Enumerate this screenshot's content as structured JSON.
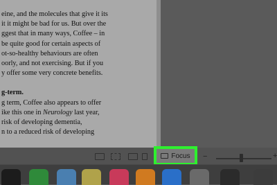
{
  "document": {
    "lines": [
      "eine, and the molecules that give it its",
      "it it might be bad for us. But over the",
      "ggest that in many ways, Coffee – in",
      "be quite good for certain aspects of",
      "ot-so-healthy behaviours are often",
      "oorly, and not exercising. But if you",
      "y offer some very concrete benefits."
    ],
    "heading": "g-term.",
    "lines2": [
      "g term, Coffee also appears to offer",
      "ike this one in Neurology last year,",
      "risk of developing dementia,",
      "n to a reduced risk of developing"
    ]
  },
  "status_bar": {
    "focus_label": "Focus",
    "zoom_minus": "−",
    "zoom_plus": "+",
    "zoom_level": 0.45
  },
  "dock": {
    "icons": [
      {
        "name": "dock-app-1-icon",
        "color": "#1c1c1c"
      },
      {
        "name": "facetime-icon",
        "color": "#2f8a3a"
      },
      {
        "name": "maps-icon",
        "color": "#4a7fb0"
      },
      {
        "name": "photos-icon",
        "color": "#b0a24a"
      },
      {
        "name": "music-icon",
        "color": "#c83a5a"
      },
      {
        "name": "books-icon",
        "color": "#d07a20"
      },
      {
        "name": "app-store-icon",
        "color": "#2a6fc8"
      },
      {
        "name": "system-preferences-icon",
        "color": "#6a6a6a"
      },
      {
        "name": "dock-app-9-icon",
        "color": "#2b2b2b"
      },
      {
        "name": "dock-app-10-icon",
        "color": "#3c3c3c"
      }
    ]
  }
}
